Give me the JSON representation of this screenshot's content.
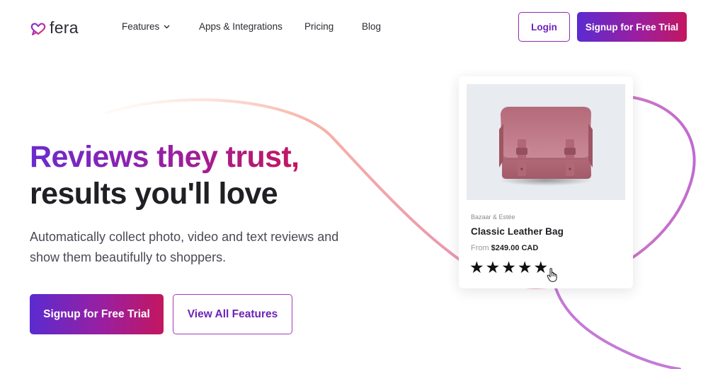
{
  "brand": {
    "name": "fera",
    "accent_start": "#5b2bd0",
    "accent_end": "#c3175f"
  },
  "nav": {
    "items": [
      {
        "label": "Features",
        "has_dropdown": true
      },
      {
        "label": "Apps & Integrations"
      },
      {
        "label": "Pricing"
      },
      {
        "label": "Blog"
      }
    ],
    "login_label": "Login",
    "signup_label": "Signup for Free Trial"
  },
  "hero": {
    "headline_line1": "Reviews they trust,",
    "headline_line2": "results you'll love",
    "subtext": "Automatically collect photo, video and text reviews and show them beautifully to shoppers.",
    "primary_cta": "Signup for Free Trial",
    "secondary_cta": "View All Features"
  },
  "product_card": {
    "brand": "Bazaar & Estée",
    "title": "Classic Leather Bag",
    "price_prefix": "From",
    "price": "$249.00 CAD",
    "rating": 5,
    "star_glyph": "★",
    "image_icon": "leather-bag-image"
  }
}
